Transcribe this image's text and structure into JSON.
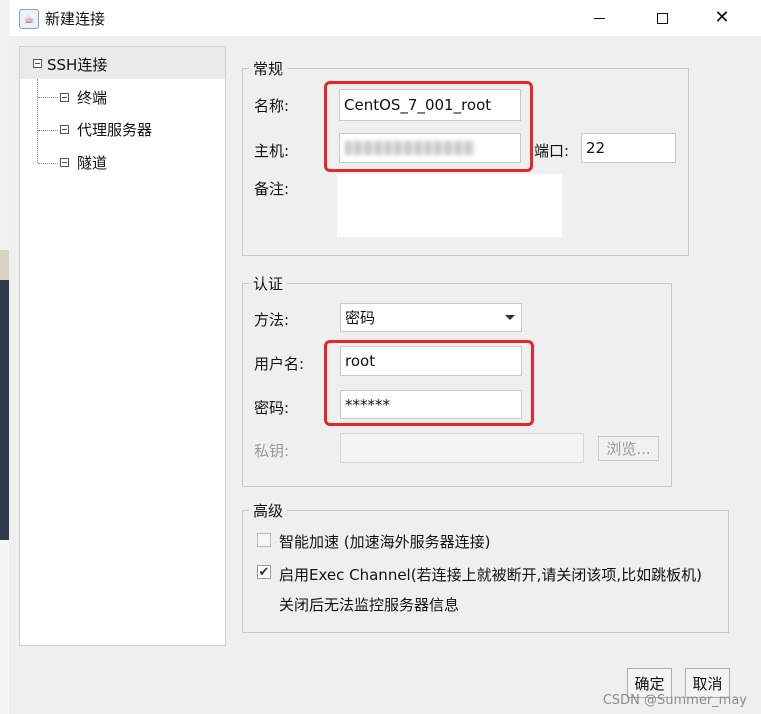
{
  "window": {
    "title": "新建连接"
  },
  "tree": {
    "root": "SSH连接",
    "children": [
      "终端",
      "代理服务器",
      "隧道"
    ]
  },
  "general": {
    "legend": "常规",
    "name_label": "名称:",
    "name_value": "CentOS_7_001_root",
    "host_label": "主机:",
    "port_label": "端口:",
    "port_value": "22",
    "note_label": "备注:"
  },
  "auth": {
    "legend": "认证",
    "method_label": "方法:",
    "method_value": "密码",
    "username_label": "用户名:",
    "username_value": "root",
    "password_label": "密码:",
    "password_value": "******",
    "key_label": "私钥:",
    "browse_label": "浏览..."
  },
  "advanced": {
    "legend": "高级",
    "smart_accel_label": "智能加速 (加速海外服务器连接)",
    "smart_accel_checked": false,
    "exec_channel_label": "启用Exec Channel(若连接上就被断开,请关闭该项,比如跳板机)",
    "exec_channel_checked": true,
    "exec_channel_note": "关闭后无法监控服务器信息"
  },
  "footer": {
    "ok_label": "确定",
    "cancel_label": "取消"
  },
  "watermark": "CSDN @Summer_may",
  "colors": {
    "highlight": "#e8262a"
  }
}
